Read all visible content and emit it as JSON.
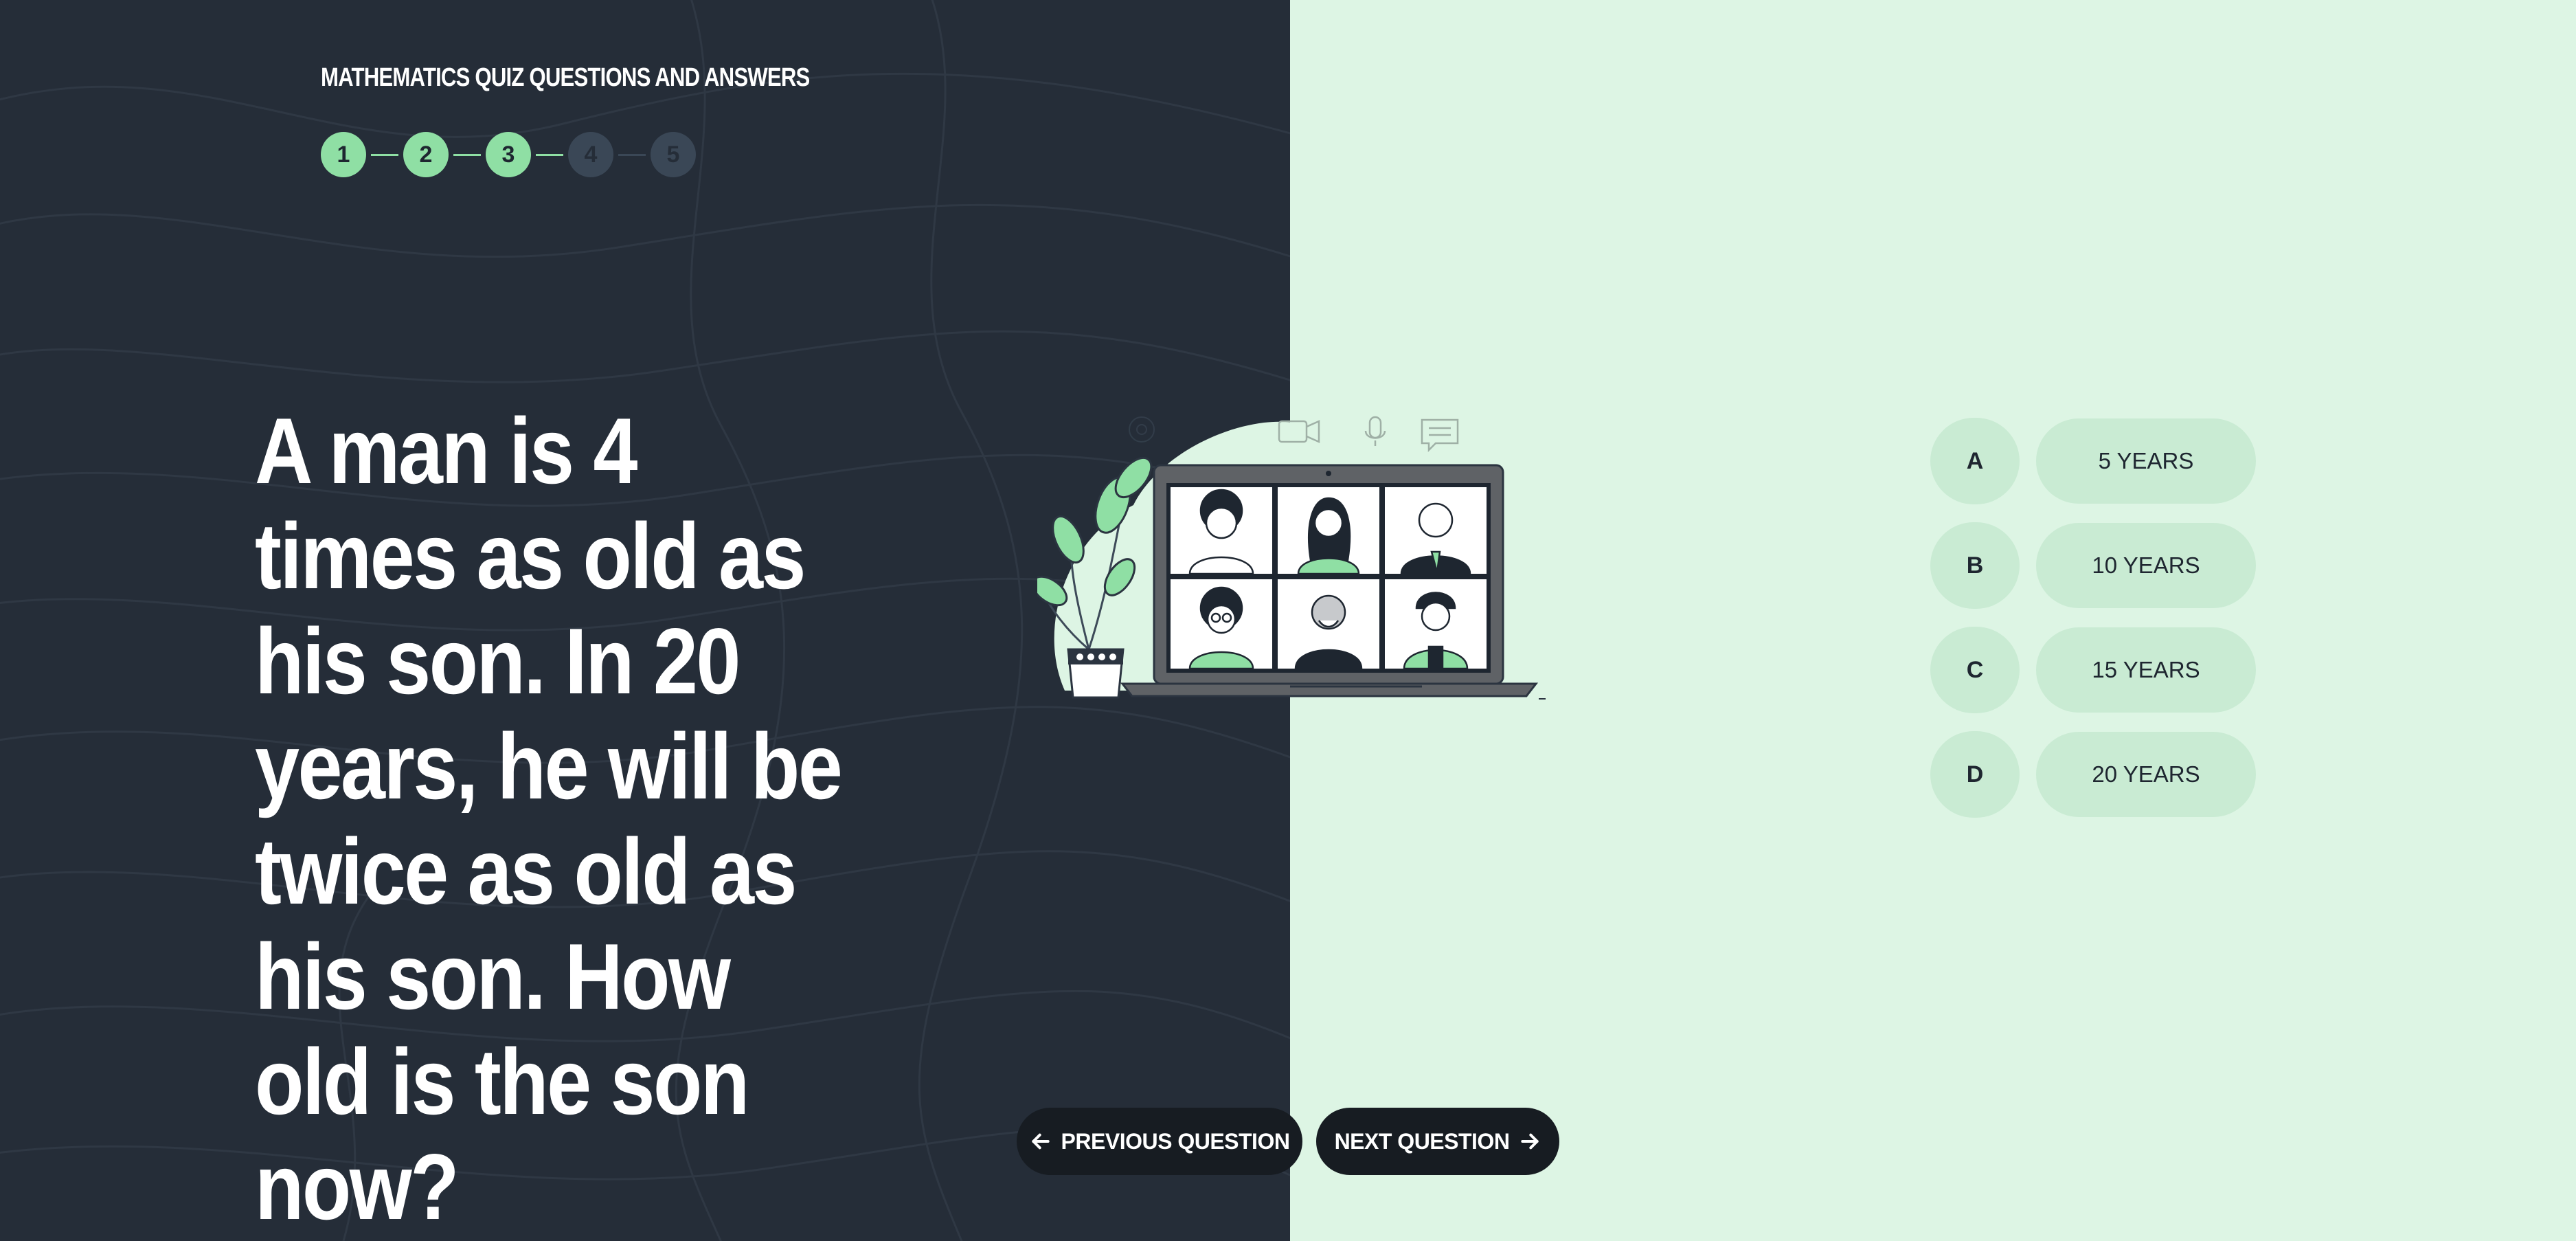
{
  "quiz": {
    "title": "MATHEMATICS QUIZ QUESTIONS AND ANSWERS",
    "steps": [
      {
        "label": "1",
        "state": "done"
      },
      {
        "label": "2",
        "state": "done"
      },
      {
        "label": "3",
        "state": "done"
      },
      {
        "label": "4",
        "state": "todo"
      },
      {
        "label": "5",
        "state": "todo"
      }
    ],
    "question": "A man is 4 times as old as his son. In 20 years, he will be twice as old as his son. How old is the son now?"
  },
  "options": [
    {
      "letter": "A",
      "value": "5 YEARS"
    },
    {
      "letter": "B",
      "value": "10 YEARS"
    },
    {
      "letter": "C",
      "value": "15 YEARS"
    },
    {
      "letter": "D",
      "value": "20 YEARS"
    }
  ],
  "navigation": {
    "previous_label": "PREVIOUS QUESTION",
    "next_label": "NEXT QUESTION"
  },
  "illustration": {
    "icons": [
      "webcam-icon",
      "video-camera-icon",
      "microphone-icon",
      "chat-icon"
    ]
  },
  "colors": {
    "dark_panel": "#252d38",
    "light_panel": "#ddf5e4",
    "accent_green": "#8fdfa4",
    "option_background": "#c9ebd3",
    "button_background": "#171c22"
  }
}
